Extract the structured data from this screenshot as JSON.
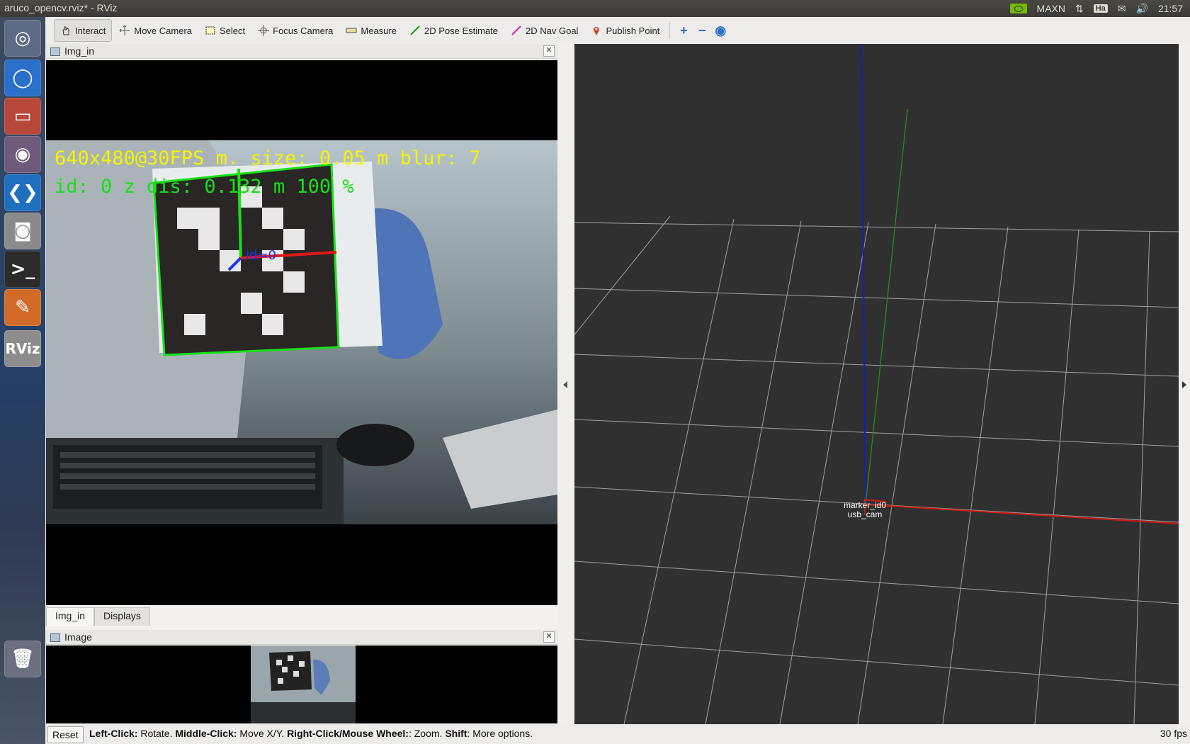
{
  "window": {
    "title": "aruco_opencv.rviz* - RViz"
  },
  "tray": {
    "gpu_mode": "MAXN",
    "keyboard": "Ha",
    "clock": "21:57"
  },
  "launcher": {
    "items": [
      {
        "name": "ubuntu-dash-icon",
        "glyph": "◎",
        "color": "#5d6b84"
      },
      {
        "name": "chromium-icon",
        "glyph": "◯",
        "color": "#2a6fc9"
      },
      {
        "name": "files-icon",
        "glyph": "▭",
        "color": "#b8473c"
      },
      {
        "name": "cheese-webcam-icon",
        "glyph": "◉",
        "color": "#6e5a7a"
      },
      {
        "name": "vscode-icon",
        "glyph": "❮❯",
        "color": "#1f6fbf"
      },
      {
        "name": "camera-icon",
        "glyph": "◙",
        "color": "#8a8a8a"
      },
      {
        "name": "terminal-icon",
        "glyph": ">_",
        "color": "#2b2b2b"
      },
      {
        "name": "text-editor-icon",
        "glyph": "✎",
        "color": "#d26b2a"
      },
      {
        "name": "rviz-icon",
        "glyph": "RViz",
        "color": "#8c8c8c"
      },
      {
        "name": "trash-icon",
        "glyph": "🗑",
        "color": "#6a7080"
      }
    ]
  },
  "toolbar": {
    "tools": [
      {
        "label": "Interact",
        "icon": "hand-icon",
        "active": true
      },
      {
        "label": "Move Camera",
        "icon": "move-camera-icon",
        "active": false
      },
      {
        "label": "Select",
        "icon": "select-icon",
        "active": false
      },
      {
        "label": "Focus Camera",
        "icon": "focus-camera-icon",
        "active": false
      },
      {
        "label": "Measure",
        "icon": "measure-icon",
        "active": false
      },
      {
        "label": "2D Pose Estimate",
        "icon": "pose-estimate-icon",
        "active": false
      },
      {
        "label": "2D Nav Goal",
        "icon": "nav-goal-icon",
        "active": false
      },
      {
        "label": "Publish Point",
        "icon": "publish-point-icon",
        "active": false
      }
    ],
    "extra": {
      "add": "+",
      "remove": "−",
      "view": "◉"
    }
  },
  "panels": {
    "img_in": {
      "title": "Img_in"
    },
    "image": {
      "title": "Image"
    },
    "tabs": [
      {
        "label": "Img_in",
        "selected": true
      },
      {
        "label": "Displays",
        "selected": false
      }
    ]
  },
  "camera_overlay": {
    "line1": "640x480@30FPS m. size: 0.05 m blur: 7",
    "line2": "id: 0 z dis: 0.132 m  100 %",
    "marker_label": "id=0"
  },
  "viewport": {
    "frame_labels": [
      "marker_id0",
      "usb_cam"
    ],
    "colors": {
      "background": "#303030",
      "grid": "#a0a0a0",
      "x_axis": "#d01818",
      "y_axis": "#1a9a1a",
      "z_axis": "#1020c0"
    }
  },
  "statusbar": {
    "reset_label": "Reset",
    "help": [
      {
        "b": "Left-Click:",
        "t": " Rotate. "
      },
      {
        "b": "Middle-Click:",
        "t": " Move X/Y. "
      },
      {
        "b": "Right-Click/Mouse Wheel:",
        "t": ": Zoom. "
      },
      {
        "b": "Shift",
        "t": ": More options."
      }
    ],
    "fps": "30 fps"
  }
}
